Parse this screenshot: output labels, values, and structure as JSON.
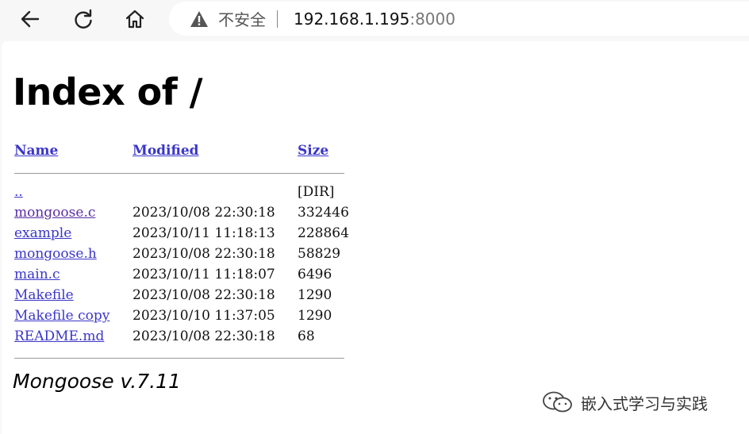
{
  "browser": {
    "security_label": "不安全",
    "url_host": "192.168.1.195",
    "url_port": ":8000",
    "icons": [
      "back-icon",
      "reload-icon",
      "home-icon",
      "warning-icon"
    ]
  },
  "page": {
    "title": "Index of /",
    "headers": {
      "name": "Name",
      "modified": "Modified",
      "size": "Size"
    },
    "parent": {
      "name": "..",
      "modified": "",
      "size": "[DIR]"
    },
    "files": [
      {
        "name": "mongoose.c",
        "modified": "2023/10/08 22:30:18",
        "size": "332446"
      },
      {
        "name": "example",
        "modified": "2023/10/11 11:18:13",
        "size": "228864"
      },
      {
        "name": "mongoose.h",
        "modified": "2023/10/08 22:30:18",
        "size": "58829"
      },
      {
        "name": "main.c",
        "modified": "2023/10/11 11:18:07",
        "size": "6496"
      },
      {
        "name": "Makefile",
        "modified": "2023/10/08 22:30:18",
        "size": "1290"
      },
      {
        "name": "Makefile copy",
        "modified": "2023/10/10 11:37:05",
        "size": "1290"
      },
      {
        "name": "README.md",
        "modified": "2023/10/08 22:30:18",
        "size": "68"
      }
    ],
    "footer": "Mongoose v.7.11"
  },
  "watermark": {
    "text": "嵌入式学习与实践"
  },
  "colors": {
    "link": "#3b36c9",
    "visited_link": "#5a2ea6",
    "toolbar_bg": "#f7f7f7"
  }
}
